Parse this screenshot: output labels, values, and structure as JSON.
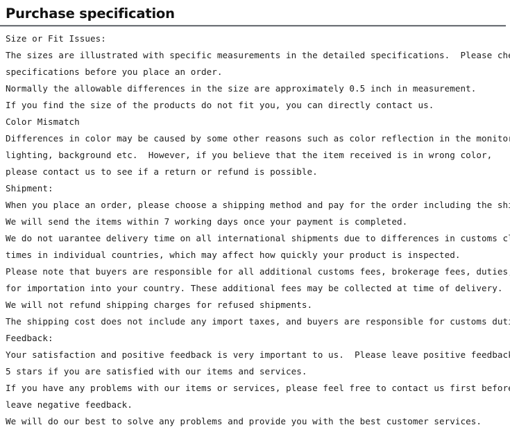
{
  "document": {
    "title": "Purchase specification",
    "lines": [
      "Size or Fit Issues:",
      "The sizes are illustrated with specific measurements in the detailed specifications.  Please check the",
      "specifications before you place an order.",
      "Normally the allowable differences in the size are approximately 0.5 inch in measurement.",
      "If you find the size of the products do not fit you, you can directly contact us.",
      "Color Mismatch",
      "Differences in color may be caused by some other reasons such as color reflection in the monitor,",
      "lighting, background etc.  However, if you believe that the item received is in wrong color,",
      "please contact us to see if a return or refund is possible.",
      "Shipment:",
      "When you place an order, please choose a shipping method and pay for the order including the shipping fee.",
      "We will send the items within 7 working days once your payment is completed.",
      "We do not uarantee delivery time on all international shipments due to differences in customs clearing",
      "times in individual countries, which may affect how quickly your product is inspected.",
      "Please note that buyers are responsible for all additional customs fees, brokerage fees, duties, and taxes",
      "for importation into your country. These additional fees may be collected at time of delivery.",
      "We will not refund shipping charges for refused shipments.",
      "The shipping cost does not include any import taxes, and buyers are responsible for customs duties.",
      "Feedback:",
      "Your satisfaction and positive feedback is very important to us.  Please leave positive feedback and",
      "5 stars if you are satisfied with our items and services.",
      "If you have any problems with our items or services, please feel free to contact us first before you",
      "leave negative feedback.",
      "We will do our best to solve any problems and provide you with the best customer services."
    ]
  },
  "colors": {
    "page_background": "#ffffff",
    "text": "#1c1c1c",
    "title": "#111111",
    "rule": "#6e7277"
  }
}
